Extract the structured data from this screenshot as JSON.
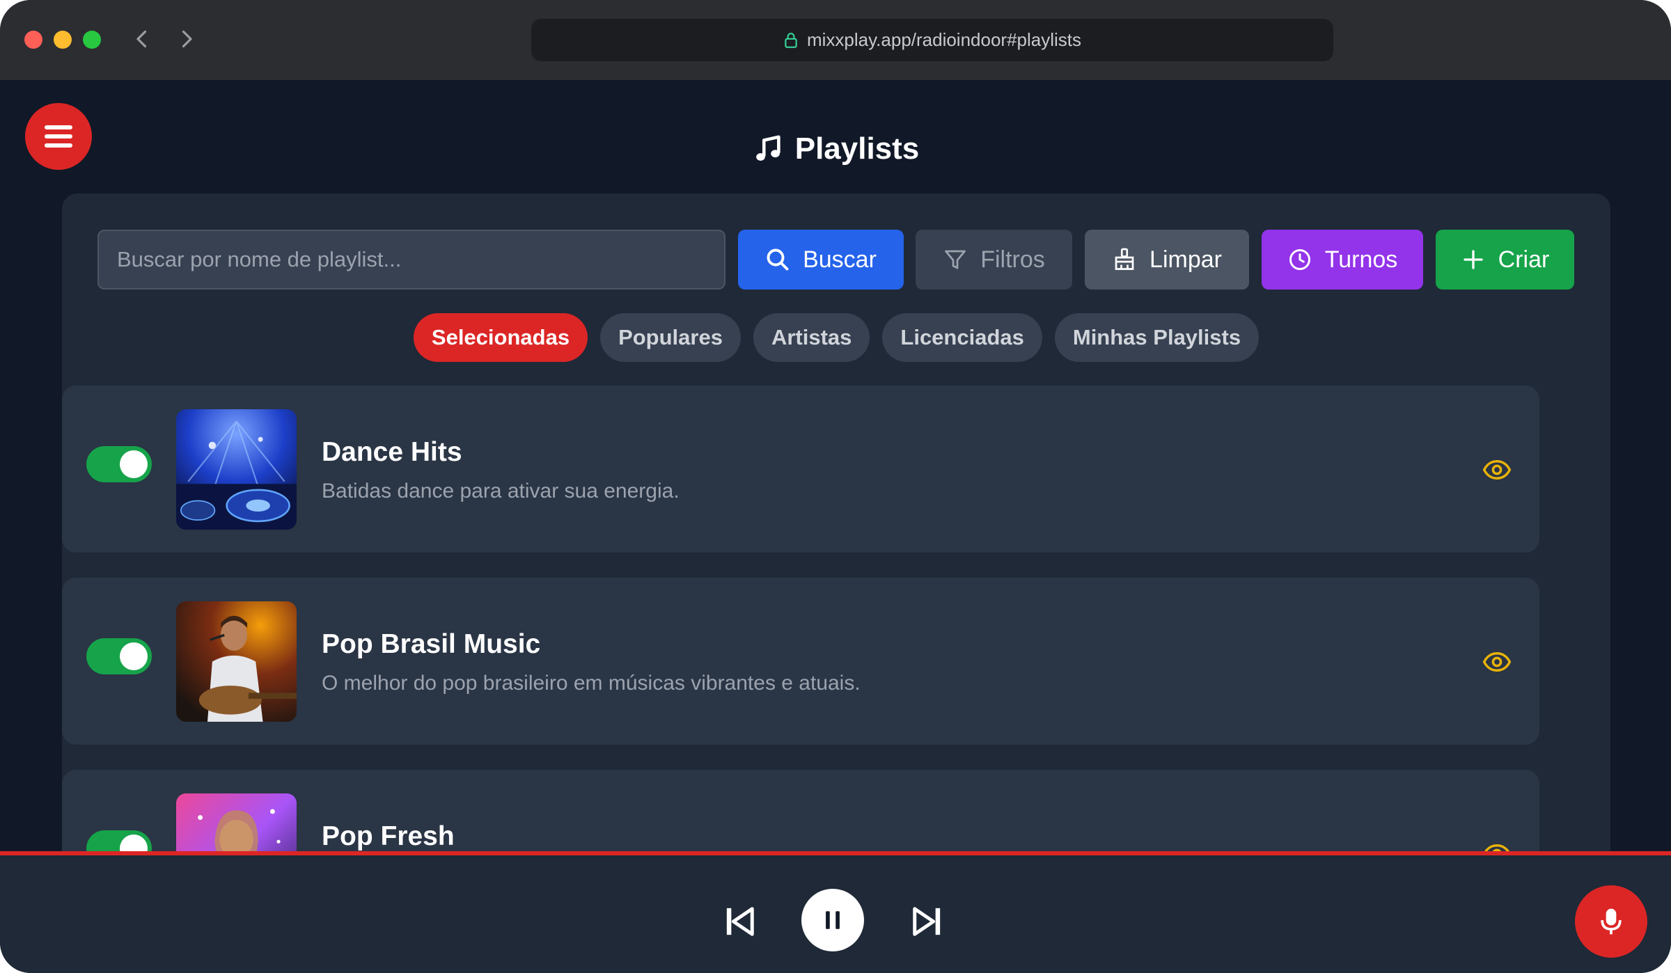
{
  "browser": {
    "url": "mixxplay.app/radioindoor#playlists"
  },
  "header": {
    "title": "Playlists"
  },
  "search": {
    "placeholder": "Buscar por nome de playlist...",
    "value": ""
  },
  "toolbar": {
    "buscar_label": "Buscar",
    "filtros_label": "Filtros",
    "limpar_label": "Limpar",
    "turnos_label": "Turnos",
    "criar_label": "Criar"
  },
  "tabs": [
    {
      "label": "Selecionadas",
      "active": true
    },
    {
      "label": "Populares",
      "active": false
    },
    {
      "label": "Artistas",
      "active": false
    },
    {
      "label": "Licenciadas",
      "active": false
    },
    {
      "label": "Minhas Playlists",
      "active": false
    }
  ],
  "playlists": [
    {
      "title": "Dance Hits",
      "description": "Batidas dance para ativar sua energia.",
      "enabled": true,
      "icon": "dj-turntable-image"
    },
    {
      "title": "Pop Brasil Music",
      "description": "O melhor do pop brasileiro em músicas vibrantes e atuais.",
      "enabled": true,
      "icon": "singer-guitar-image"
    },
    {
      "title": "Pop Fresh",
      "description": "",
      "enabled": true,
      "icon": "pop-singer-image"
    }
  ],
  "colors": {
    "background": "#111827",
    "panel": "#1f2937",
    "card": "#2a3545",
    "accent_red": "#dc2626",
    "blue": "#2563eb",
    "purple": "#9333ea",
    "green": "#16a34a",
    "eye_yellow": "#eab308"
  },
  "player": {
    "state": "playing"
  }
}
